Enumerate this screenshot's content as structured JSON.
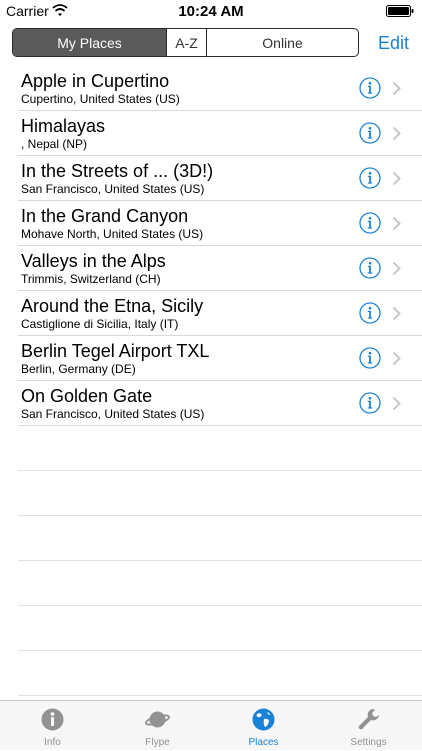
{
  "status": {
    "carrier": "Carrier",
    "time": "10:24 AM"
  },
  "segments": [
    "My Places",
    "A-Z",
    "Online"
  ],
  "nav": {
    "edit_label": "Edit"
  },
  "places": [
    {
      "title": "Apple in Cupertino",
      "subtitle": "Cupertino, United States (US)"
    },
    {
      "title": "Himalayas",
      "subtitle": ", Nepal (NP)"
    },
    {
      "title": "In the Streets of ... (3D!)",
      "subtitle": "San Francisco, United States (US)"
    },
    {
      "title": "In the Grand Canyon",
      "subtitle": "Mohave North, United States (US)"
    },
    {
      "title": "Valleys in the Alps",
      "subtitle": "Trimmis, Switzerland (CH)"
    },
    {
      "title": "Around the Etna, Sicily",
      "subtitle": "Castiglione di Sicilia, Italy (IT)"
    },
    {
      "title": "Berlin Tegel Airport TXL",
      "subtitle": "Berlin, Germany (DE)"
    },
    {
      "title": "On Golden Gate",
      "subtitle": "San Francisco, United States (US)"
    }
  ],
  "tabs": [
    {
      "label": "Info",
      "icon": "info-icon"
    },
    {
      "label": "Flype",
      "icon": "planet-icon"
    },
    {
      "label": "Places",
      "icon": "globe-icon"
    },
    {
      "label": "Settings",
      "icon": "wrench-icon"
    }
  ],
  "colors": {
    "accent": "#1a82d6",
    "segment_active": "#5a5a5a",
    "tab_inactive": "#929292"
  }
}
